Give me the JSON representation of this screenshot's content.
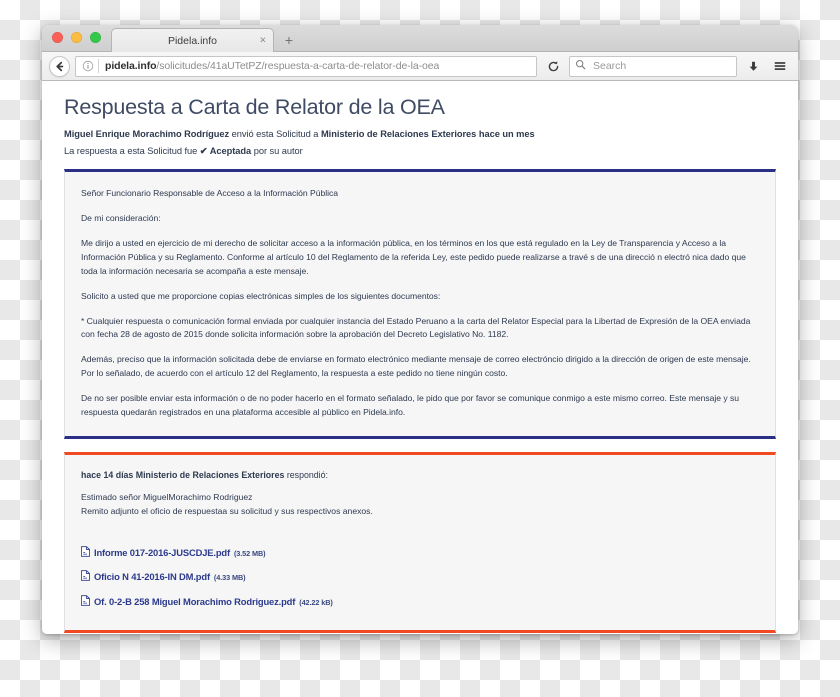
{
  "browser": {
    "tab": {
      "title": "Pidela.info",
      "close_label": "×"
    },
    "new_tab_label": "+",
    "url": {
      "domain": "pidela.info",
      "path": "/solicitudes/41aUTetPZ/respuesta-a-carta-de-relator-de-la-oea"
    },
    "search_placeholder": "Search",
    "reload_label": "↻"
  },
  "page": {
    "title": "Respuesta a Carta de Relator de la OEA",
    "subline": {
      "author": "Miguel Enrique Morachimo Rodríguez",
      "mid": " envió esta Solicitud a ",
      "recipient": "Ministerio de Relaciones Exteriores hace un mes"
    },
    "status": {
      "prefix": "La respuesta a esta Solicitud fue ",
      "check": "✔ Aceptada",
      "suffix": " por su autor"
    }
  },
  "request": {
    "paragraphs": [
      "Señor Funcionario Responsable de Acceso a la Información Pública",
      "De mi consideración:",
      "Me dirijo a usted en ejercicio de mi derecho de solicitar acceso a la información pública, en los términos en los que está regulado en la Ley de Transparencia y Acceso a la Información Pública y su Reglamento. Conforme al artículo 10 del Reglamento de la referida Ley, este pedido puede realizarse a travé s de una direcció n electró nica dado que toda la información necesaria se acompaña a este mensaje.",
      "Solicito a usted que me proporcione copias electrónicas simples de los siguientes documentos:",
      "* Cualquier respuesta o comunicación formal enviada por cualquier instancia del Estado Peruano a la carta del Relator Especial para la Libertad de Expresión de la OEA enviada con fecha 28 de agosto de 2015 donde solicita información sobre la aprobación del Decreto Legislativo No. 1182.",
      "Además, preciso que la información solicitada debe de enviarse en formato electrónico mediante mensaje de correo electróncio dirigido a la dirección de origen de este mensaje. Por lo señalado, de acuerdo con el artículo 12 del Reglamento, la respuesta a este pedido no tiene ningún costo.",
      "De no ser posible enviar esta información o de no poder hacerlo en el formato señalado, le pido que por favor se comunique conmigo a este mismo correo. Este mensaje y su respuesta quedarán registrados en una plataforma accesible al público en Pidela.info."
    ]
  },
  "response": {
    "head": {
      "bold": "hace 14 días Ministerio de Relaciones Exteriores",
      "rest": " respondió:"
    },
    "body": "Estimado señor  MiguelMorachimo Rodriguez\n Remito adjunto el oficio de respuestaa su solicitud y sus respectivos anexos.",
    "attachments": [
      {
        "name": "Informe 017-2016-JUSCDJE.pdf",
        "size": "(3.52 MB)"
      },
      {
        "name": "Oficio N 41-2016-IN DM.pdf",
        "size": "(4.33 MB)"
      },
      {
        "name": "Of. 0-2-B 258 Miguel Morachimo Rodriguez.pdf",
        "size": "(42.22 kB)"
      }
    ]
  },
  "colors": {
    "request_border": "#2c2f86",
    "response_border": "#f04a23",
    "link": "#2c3a8c",
    "title": "#3f4b63"
  }
}
